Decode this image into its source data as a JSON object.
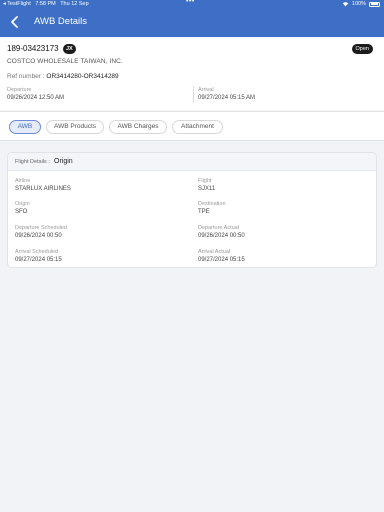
{
  "status_bar": {
    "app": "◂ TestFlight",
    "time": "7:58 PM",
    "date": "Thu 12 Sep",
    "battery": "100%"
  },
  "nav": {
    "title": "AWB Details"
  },
  "awb": {
    "number": "189-03423173",
    "code": "JX",
    "status": "Open",
    "company": "COSTCO WHOLESALE TAIWAN, INC.",
    "ref_label": "Ref number :",
    "ref_value": "OR3414280-OR3414289",
    "departure_label": "Departure",
    "departure_value": "09/26/2024  12:50 AM",
    "arrival_label": "Arrival",
    "arrival_value": "09/27/2024  05:15 AM"
  },
  "tabs": [
    "AWB",
    "AWB Products",
    "AWB Charges",
    "Attachment"
  ],
  "active_tab": "AWB",
  "flight_details": {
    "header_label": "Flight Details :",
    "header_value": "Origin",
    "airline_label": "Airline",
    "airline_value": "STARLUX AIRLINES",
    "flight_label": "Flight",
    "flight_value": "SJX11",
    "origin_label": "Origin",
    "origin_value": "SFO",
    "destination_label": "Destination",
    "destination_value": "TPE",
    "dep_sched_label": "Departure Scheduled",
    "dep_sched_value": "09/26/2024 00:50",
    "dep_actual_label": "Departure Actual",
    "dep_actual_value": "09/26/2024 00:50",
    "arr_sched_label": "Arrival Scheduled",
    "arr_sched_value": "09/27/2024 05:15",
    "arr_actual_label": "Arrival Actual",
    "arr_actual_value": "09/27/2024  05:15"
  },
  "colors": {
    "primary": "#3d6fc6",
    "active_tab_bg": "#e6ebfa",
    "badge_bg": "#1c1c1c"
  }
}
